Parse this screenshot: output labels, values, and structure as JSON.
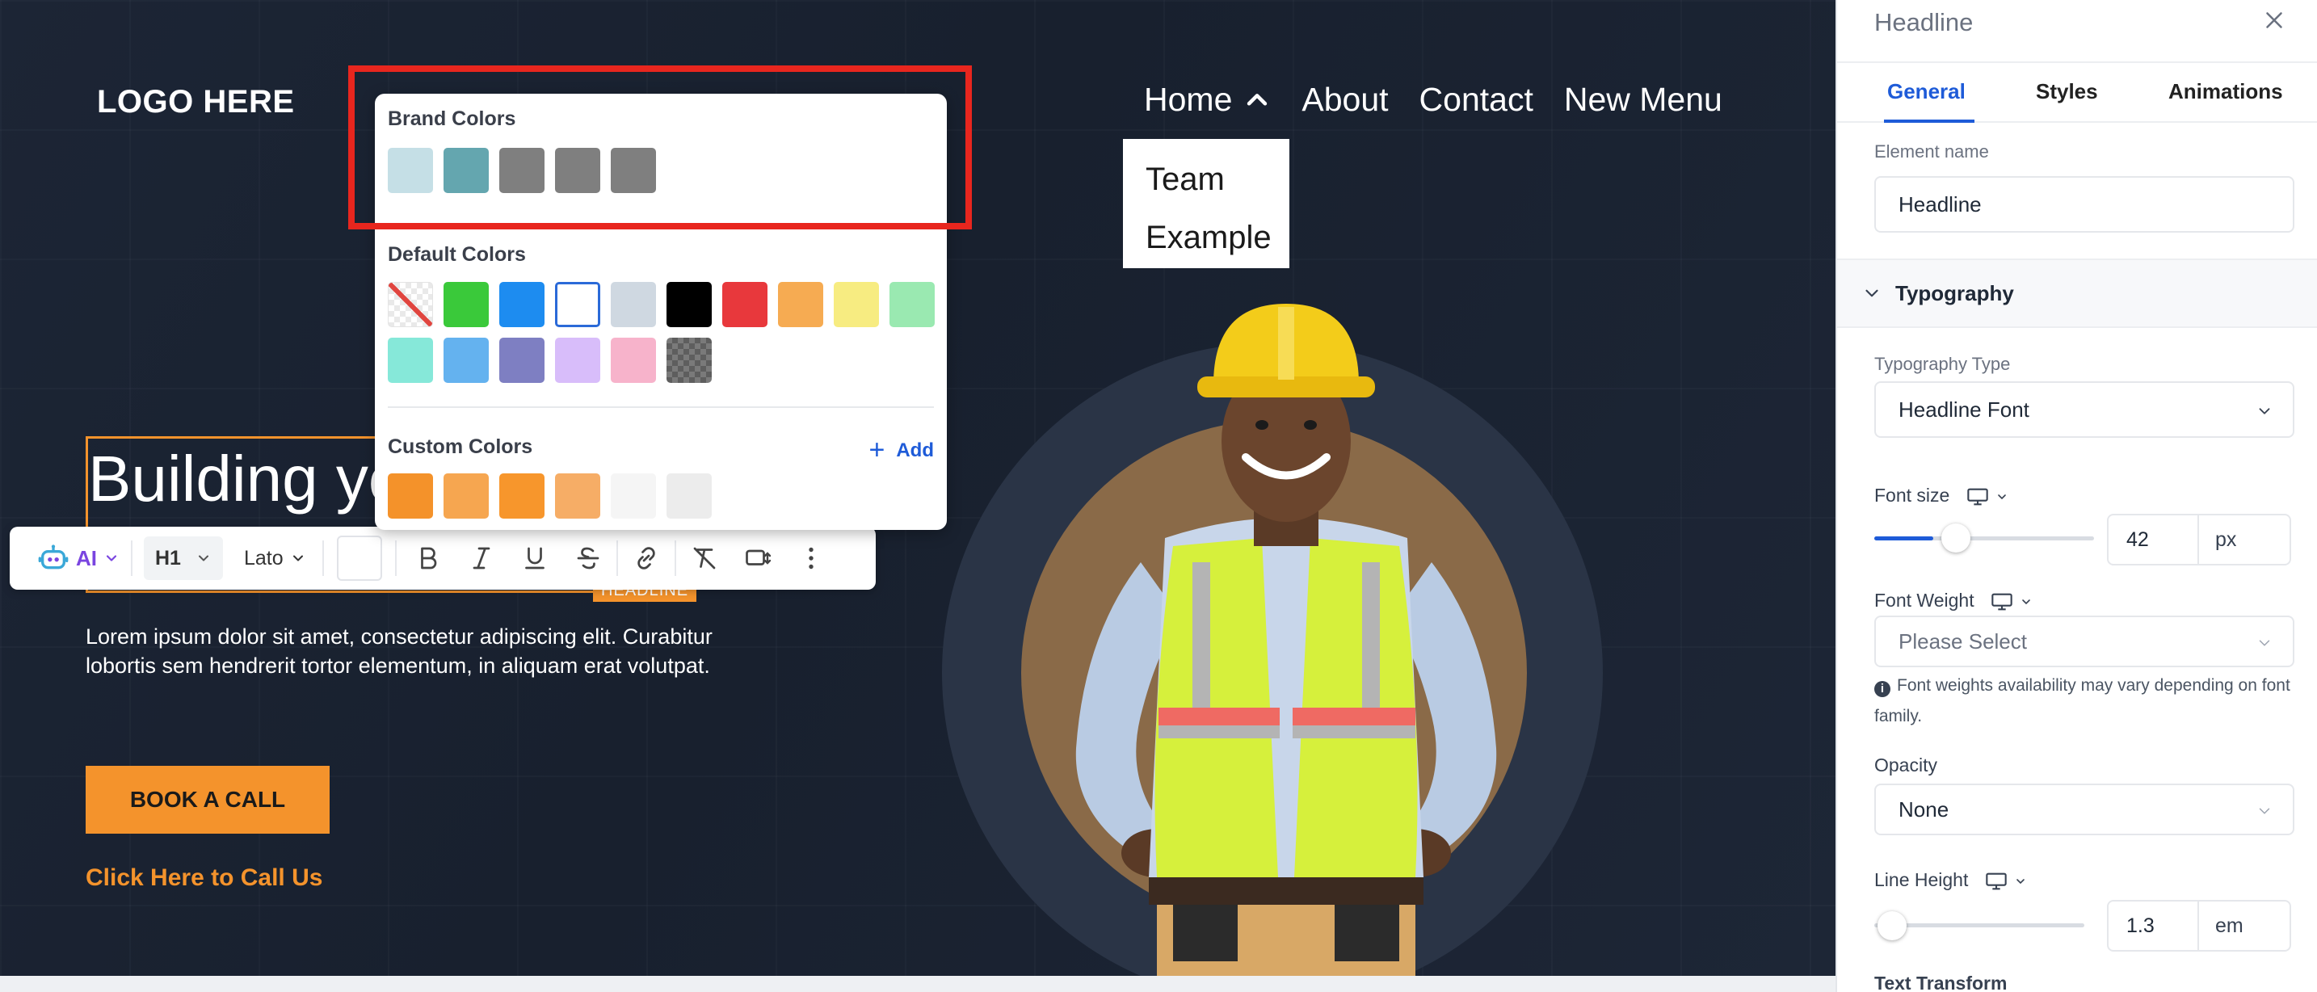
{
  "canvas": {
    "logo": "LOGO HERE",
    "nav": [
      "Home",
      "About",
      "Contact",
      "New Menu"
    ],
    "submenu": [
      "Team",
      "Example"
    ],
    "headline": "Building yo",
    "headline_tag": "HEADLINE",
    "body": "Lorem ipsum dolor sit amet, consectetur adipiscing elit. Curabitur lobortis sem hendrerit tortor elementum, in aliquam erat volutpat.",
    "cta_button": "BOOK A CALL",
    "call_link": "Click Here to Call Us"
  },
  "toolbar": {
    "ai_label": "AI",
    "heading_level": "H1",
    "font": "Lato",
    "icons": [
      "bold-icon",
      "italic-icon",
      "underline-icon",
      "strikethrough-icon",
      "link-icon",
      "clear-format-icon",
      "resize-icon",
      "more-vertical-icon"
    ]
  },
  "color_picker": {
    "brand_title": "Brand Colors",
    "brand_colors": [
      "#c5dfe6",
      "#64a6af",
      "#7f7f7f",
      "#7f7f7f",
      "#7f7f7f"
    ],
    "default_title": "Default Colors",
    "default_colors": [
      "transparent",
      "#3ac93a",
      "#1d8cf0",
      "#ffffff",
      "#cfd8e1",
      "#000000",
      "#e8383c",
      "#f6ab52",
      "#f7ec81",
      "#9ae9b1",
      "#86e8d9",
      "#64b2ef",
      "#7e7fc2",
      "#d8bdfa",
      "#f7b3cb",
      "checker"
    ],
    "custom_title": "Custom Colors",
    "add_label": "Add",
    "custom_colors": [
      "#f4922a",
      "#f6a650",
      "#f7962c",
      "#f6ad66",
      "#f5f5f5",
      "#ececec"
    ]
  },
  "panel": {
    "title": "Headline",
    "tabs": [
      "General",
      "Styles",
      "Animations"
    ],
    "element_name_label": "Element name",
    "element_name_value": "Headline",
    "typography_section": "Typography",
    "typography_type_label": "Typography Type",
    "typography_type_value": "Headline Font",
    "font_size_label": "Font size",
    "font_size_value": "42",
    "font_size_unit": "px",
    "font_size_slider": 0.42,
    "font_weight_label": "Font Weight",
    "font_weight_placeholder": "Please Select",
    "font_weight_note": "Font weights availability may vary depending on font family.",
    "opacity_label": "Opacity",
    "opacity_value": "None",
    "line_height_label": "Line Height",
    "line_height_value": "1.3",
    "line_height_unit": "em",
    "line_height_slider": 0.0,
    "text_transform_label": "Text Transform"
  }
}
